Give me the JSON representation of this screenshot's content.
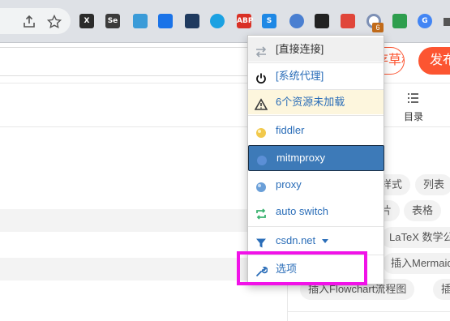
{
  "browser": {
    "badge_count": "6",
    "extensions": [
      {
        "name": "x-extension-icon",
        "text": "X",
        "color": "#2b2b2b"
      },
      {
        "name": "selenium-extension-icon",
        "text": "Se",
        "color": "#3b3b3b"
      },
      {
        "name": "globe-extension-icon",
        "text": "",
        "color": "#3a9bd8"
      },
      {
        "name": "squares-extension-icon",
        "text": "",
        "color": "#1a73e8"
      },
      {
        "name": "check-extension-icon",
        "text": "",
        "color": "#1f3a5f"
      },
      {
        "name": "hexagon-extension-icon",
        "text": "",
        "color": "#1ba1e2"
      },
      {
        "name": "adblock-extension-icon",
        "text": "ABP",
        "color": "#d93025"
      },
      {
        "name": "s-extension-icon",
        "text": "S",
        "color": "#1e88e5"
      },
      {
        "name": "info-extension-icon",
        "text": "",
        "color": "#4a7fd1"
      },
      {
        "name": "game-extension-icon",
        "text": "",
        "color": "#222222"
      },
      {
        "name": "dice-extension-icon",
        "text": "",
        "color": "#e0463a"
      },
      {
        "name": "proxy-extension-icon",
        "text": "",
        "color": "#5a6b86"
      },
      {
        "name": "green-extension-icon",
        "text": "",
        "color": "#2e9e4e"
      },
      {
        "name": "translate-extension-icon",
        "text": "G",
        "color": "#4285f4"
      }
    ]
  },
  "page": {
    "draft_button": "存草稿",
    "publish_button": "发布",
    "toc_label": "目录",
    "chips": [
      "样式",
      "列表",
      "片",
      "表格",
      "LaTeX 数学公式",
      "插入Mermaid",
      "插入Flowchart流程图",
      "插"
    ]
  },
  "menu": {
    "items": [
      {
        "label": "[直接连接]",
        "icon": "swap-arrows-icon",
        "color": "#9aa3ad"
      },
      {
        "label": "[系统代理]",
        "icon": "power-icon",
        "color": "#111111"
      },
      {
        "label": "6个资源未加载",
        "icon": "warning-icon",
        "color": "#3a3a3a"
      },
      {
        "label": "fiddler",
        "icon": "yellow-globe-icon",
        "color": "#f2c94c"
      },
      {
        "label": "mitmproxy",
        "icon": "blue-globe-icon",
        "color": "#5b8fd6"
      },
      {
        "label": "proxy",
        "icon": "globe-icon",
        "color": "#6a9fd8"
      },
      {
        "label": "auto switch",
        "icon": "auto-switch-icon",
        "color": "#3cb371"
      },
      {
        "label": "csdn.net",
        "icon": "filter-icon",
        "color": "#2a6db8"
      },
      {
        "label": "选项",
        "icon": "wrench-icon",
        "color": "#2a6db8"
      }
    ]
  },
  "colors": {
    "accent": "#fc5531",
    "menu_text": "#2a6db8",
    "menu_active": "#3d7ab8",
    "highlight": "#f112e8"
  }
}
